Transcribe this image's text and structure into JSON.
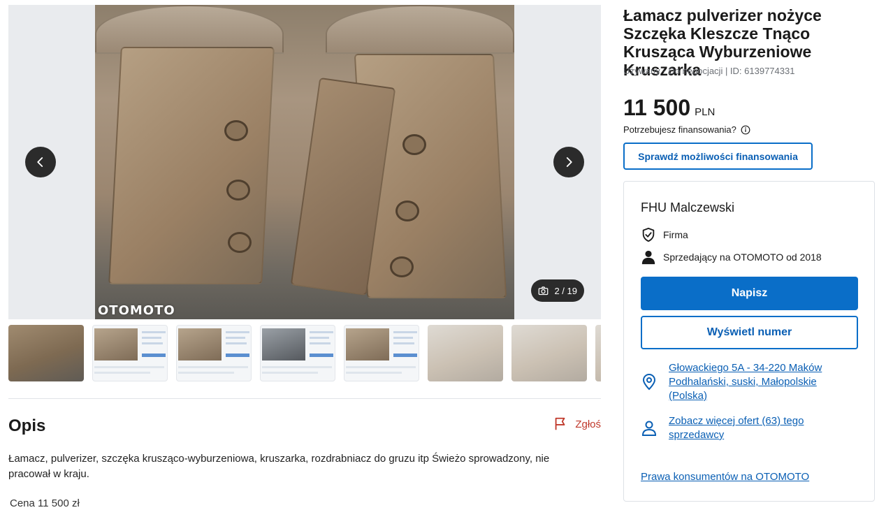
{
  "gallery": {
    "watermark": "OTOMOTO",
    "counter": "2 / 19",
    "thumbnail_count": 8
  },
  "listing": {
    "title": "Łamacz pulverizer nożyce Szczęka Kleszcze Tnąco Krusząca Wyburzeniowe Kruszarka",
    "meta": "Używany · Do negocjacji | ID: 6139774331",
    "price_value": "11 500",
    "price_currency": "PLN",
    "finance_question": "Potrzebujesz finansowania?",
    "finance_button": "Sprawdź możliwości finansowania"
  },
  "seller": {
    "name": "FHU Malczewski",
    "type": "Firma",
    "since": "Sprzedający na OTOMOTO od 2018",
    "write_button": "Napisz",
    "show_number_button": "Wyświetl numer",
    "address": "Głowackiego 5A - 34-220 Maków Podhalański, suski, Małopolskie (Polska)",
    "more_offers": "Zobacz więcej ofert (63) tego sprzedawcy",
    "consumer_rights": "Prawa konsumentów na OTOMOTO"
  },
  "description": {
    "heading": "Opis",
    "report": "Zgłoś",
    "text": "Łamacz, pulverizer, szczęka krusząco-wyburzeniowa, kruszarka, rozdrabniacz do gruzu itp Świeżo sprowadzony, nie pracował w kraju.",
    "price_line": "Cena 11 500 zł"
  },
  "colors": {
    "accent": "#0a6ec8",
    "link": "#0a5fb4",
    "report": "#c0392b"
  }
}
